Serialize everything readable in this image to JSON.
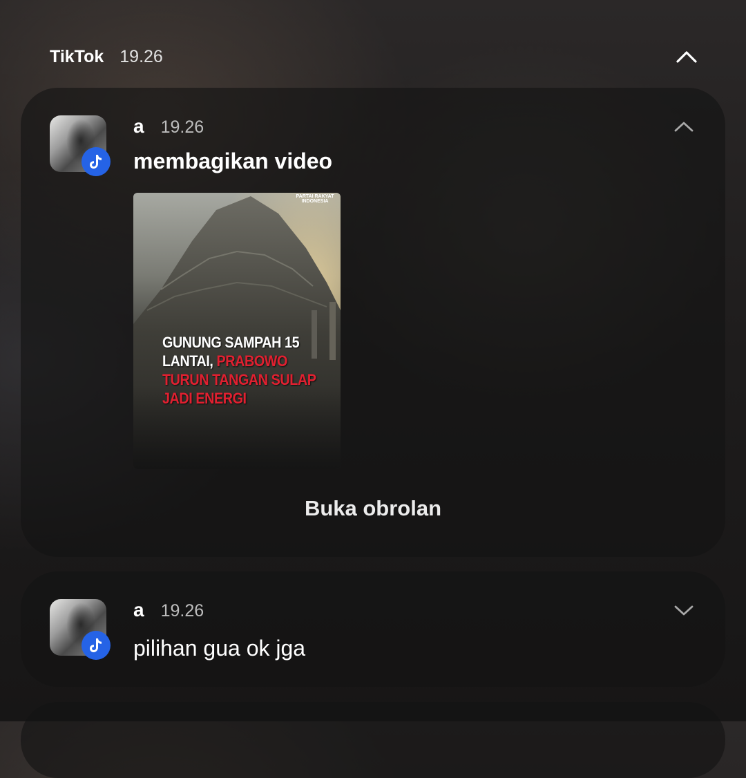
{
  "group": {
    "app_name": "TikTok",
    "time": "19.26"
  },
  "notifications": [
    {
      "sender": "a",
      "time": "19.26",
      "message": "membagikan video",
      "expanded": true,
      "video": {
        "brand": "PARTAI RAKYAT INDONESIA",
        "headline_white": "GUNUNG SAMPAH 15 LANTAI, ",
        "headline_red": "PRABOWO TURUN TANGAN SULAP JADI ENERGI"
      },
      "action_label": "Buka obrolan"
    },
    {
      "sender": "a",
      "time": "19.26",
      "message": "pilihan gua ok jga",
      "expanded": false
    }
  ],
  "icons": {
    "group_collapse": "chevron-up-icon",
    "badge": "tiktok-icon",
    "collapse": "chevron-up-icon",
    "expand": "chevron-down-icon"
  },
  "colors": {
    "badge_blue": "#2563e6",
    "headline_red": "#e02030"
  }
}
